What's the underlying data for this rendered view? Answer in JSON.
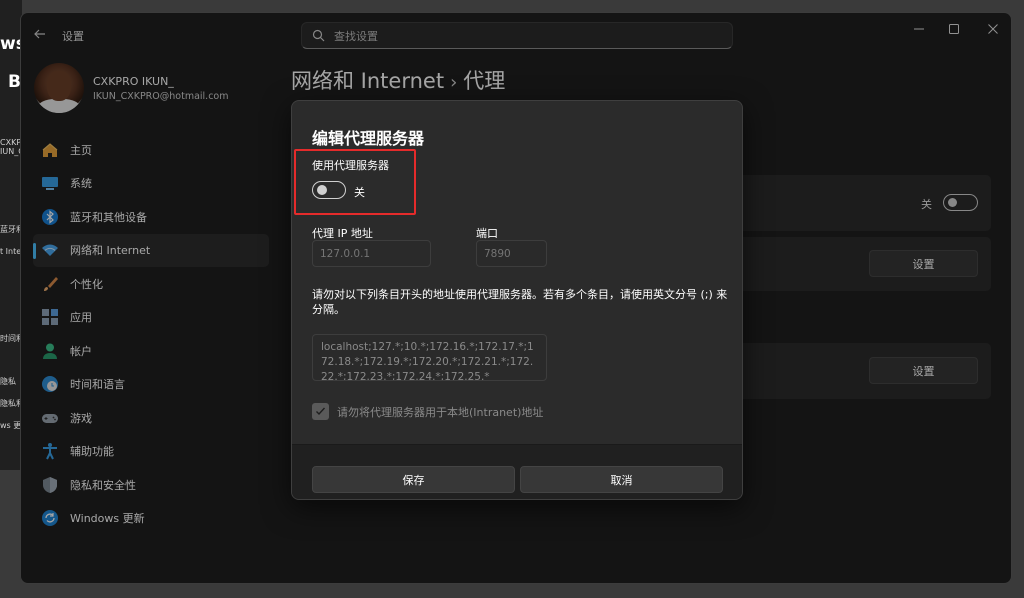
{
  "background_window": {
    "fragments": [
      "ws1",
      "B",
      "CXKPRO",
      "IUN_CX",
      "蓝牙和其他",
      "t Inter",
      "时间和语言",
      "隐私",
      "隐私和安全性",
      "ws 更新"
    ]
  },
  "window": {
    "title": "设置",
    "search_placeholder": "查找设置",
    "icons": {
      "back": "back-arrow-icon",
      "minimize": "minimize-icon",
      "maximize": "maximize-icon",
      "close": "close-icon"
    }
  },
  "profile": {
    "name": "CXKPRO IKUN_",
    "email": "IKUN_CXKPRO@hotmail.com"
  },
  "sidebar": {
    "items": [
      {
        "label": "主页",
        "icon": "home-icon",
        "active": false
      },
      {
        "label": "系统",
        "icon": "system-icon",
        "active": false
      },
      {
        "label": "蓝牙和其他设备",
        "icon": "bluetooth-icon",
        "active": false
      },
      {
        "label": "网络和 Internet",
        "icon": "network-icon",
        "active": true
      },
      {
        "label": "个性化",
        "icon": "brush-icon",
        "active": false
      },
      {
        "label": "应用",
        "icon": "apps-icon",
        "active": false
      },
      {
        "label": "帐户",
        "icon": "account-icon",
        "active": false
      },
      {
        "label": "时间和语言",
        "icon": "time-language-icon",
        "active": false
      },
      {
        "label": "游戏",
        "icon": "gaming-icon",
        "active": false
      },
      {
        "label": "辅助功能",
        "icon": "accessibility-icon",
        "active": false
      },
      {
        "label": "隐私和安全性",
        "icon": "shield-icon",
        "active": false
      },
      {
        "label": "Windows 更新",
        "icon": "update-icon",
        "active": false
      }
    ]
  },
  "content": {
    "breadcrumb_parent": "网络和 Internet",
    "breadcrumb_separator": "›",
    "breadcrumb_current": "代理",
    "toggle_state": "关",
    "settings_button_1": "设置",
    "settings_button_2": "设置"
  },
  "dialog": {
    "title": "编辑代理服务器",
    "use_proxy_label": "使用代理服务器",
    "use_proxy_state": "关",
    "ip_label": "代理 IP 地址",
    "ip_placeholder": "127.0.0.1",
    "port_label": "端口",
    "port_placeholder": "7890",
    "bypass_description": "请勿对以下列条目开头的地址使用代理服务器。若有多个条目，请使用英文分号 (;) 来分隔。",
    "bypass_list": "localhost;127.*;10.*;172.16.*;172.17.*;172.18.*;172.19.*;172.20.*;172.21.*;172.22.*;172.23.*;172.24.*;172.25.*",
    "local_checkbox_label": "请勿将代理服务器用于本地(Intranet)地址",
    "local_checkbox_checked": true,
    "save_label": "保存",
    "cancel_label": "取消"
  },
  "colors": {
    "accent": "#4cc2ff",
    "highlight_box": "#e52b2b",
    "window_bg": "#202020",
    "dialog_bg": "#2b2b2b"
  }
}
